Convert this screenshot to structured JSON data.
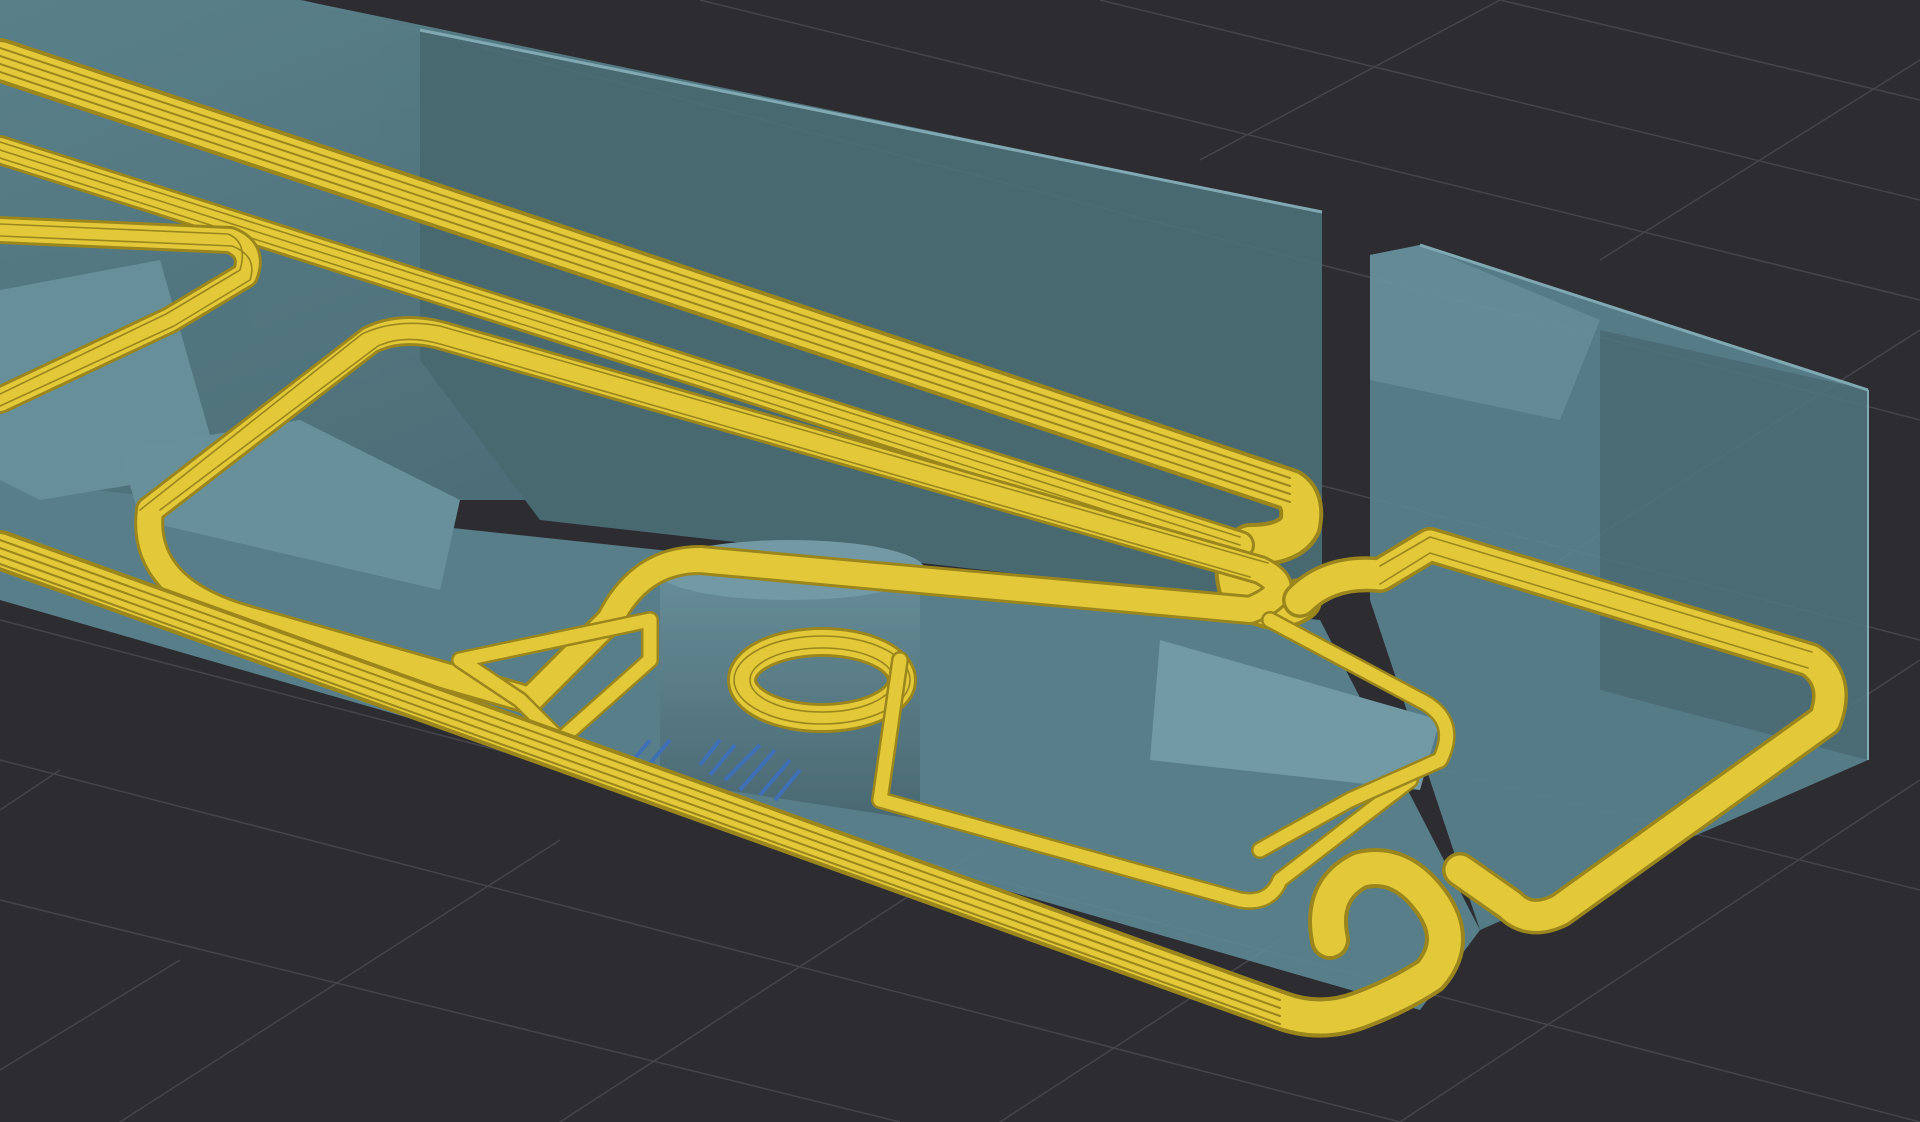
{
  "viewport": {
    "view": "slicer-3d-preview",
    "background_color": "#2d2c31",
    "grid_color": "#45444b",
    "model_color": "#7fb4c2",
    "perimeter_color": "#e3c93a",
    "perimeter_shade_color": "#9a861d",
    "infill_color": "#3f6fb4",
    "labels": []
  }
}
